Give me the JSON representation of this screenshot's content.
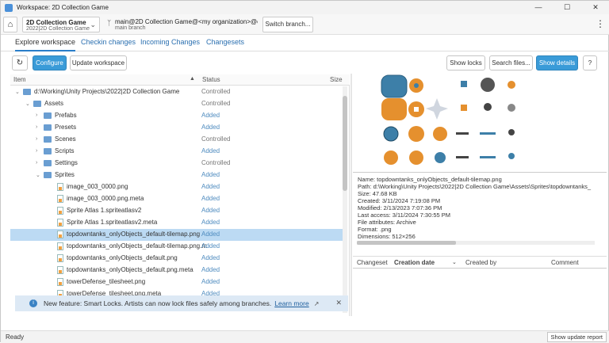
{
  "window": {
    "title": "Workspace: 2D Collection Game"
  },
  "topbar": {
    "repo_name": "2D Collection Game",
    "repo_sub": "2022|2D Collection Game",
    "branch_name": "main@2D Collection Game@<my organization>@cl",
    "branch_sub": "main branch",
    "switch_label": "Switch branch..."
  },
  "tabs": [
    {
      "label": "Explore workspace"
    },
    {
      "label": "Checkin changes"
    },
    {
      "label": "Incoming Changes"
    },
    {
      "label": "Changesets"
    }
  ],
  "toolbar": {
    "configure": "Configure",
    "update": "Update workspace",
    "show_locks": "Show locks",
    "search_files": "Search files...",
    "show_details": "Show details"
  },
  "table": {
    "col_item": "Item",
    "col_status": "Status",
    "col_size": "Size",
    "rows": [
      {
        "name": "d:\\Working\\Unity Projects\\2022|2D Collection Game",
        "status": "Controlled",
        "indent": 0,
        "kind": "folder",
        "exp": "open"
      },
      {
        "name": "Assets",
        "status": "Controlled",
        "indent": 1,
        "kind": "folder",
        "exp": "open"
      },
      {
        "name": "Prefabs",
        "status": "Added",
        "indent": 2,
        "kind": "folder",
        "exp": "closed"
      },
      {
        "name": "Presets",
        "status": "Added",
        "indent": 2,
        "kind": "folder",
        "exp": "closed"
      },
      {
        "name": "Scenes",
        "status": "Controlled",
        "indent": 2,
        "kind": "folder",
        "exp": "closed"
      },
      {
        "name": "Scripts",
        "status": "Added",
        "indent": 2,
        "kind": "folder",
        "exp": "closed"
      },
      {
        "name": "Settings",
        "status": "Controlled",
        "indent": 2,
        "kind": "folder",
        "exp": "closed"
      },
      {
        "name": "Sprites",
        "status": "Added",
        "indent": 2,
        "kind": "folder",
        "exp": "open"
      },
      {
        "name": "image_003_0000.png",
        "status": "Added",
        "indent": 3,
        "kind": "file"
      },
      {
        "name": "image_003_0000.png.meta",
        "status": "Added",
        "indent": 3,
        "kind": "file"
      },
      {
        "name": "Sprite Atlas 1.spriteatlasv2",
        "status": "Added",
        "indent": 3,
        "kind": "file"
      },
      {
        "name": "Sprite Atlas 1.spriteatlasv2.meta",
        "status": "Added",
        "indent": 3,
        "kind": "file"
      },
      {
        "name": "topdowntanks_onlyObjects_default-tilemap.png",
        "status": "Added",
        "indent": 3,
        "kind": "file",
        "selected": true
      },
      {
        "name": "topdowntanks_onlyObjects_default-tilemap.png.m",
        "status": "Added",
        "indent": 3,
        "kind": "file"
      },
      {
        "name": "topdowntanks_onlyObjects_default.png",
        "status": "Added",
        "indent": 3,
        "kind": "file"
      },
      {
        "name": "topdowntanks_onlyObjects_default.png.meta",
        "status": "Added",
        "indent": 3,
        "kind": "file"
      },
      {
        "name": "towerDefense_tilesheet.png",
        "status": "Added",
        "indent": 3,
        "kind": "file"
      },
      {
        "name": "towerDefense_tilesheet.png.meta",
        "status": "Added",
        "indent": 3,
        "kind": "file"
      }
    ]
  },
  "notice": {
    "text": "New feature: Smart Locks. Artists can now lock files safely among branches.",
    "link": "Learn more"
  },
  "details": {
    "name": "Name: topdowntanks_onlyObjects_default-tilemap.png",
    "path": "Path: d:\\Working\\Unity Projects\\2022|2D Collection Game\\Assets\\Sprites\\topdowntanks_",
    "size": "Size: 47.68 KB",
    "created": "Created: 3/11/2024 7:19:08 PM",
    "modified": "Modified: 2/13/2023 7:07:36 PM",
    "last_access": "Last access: 3/11/2024 7:30:55 PM",
    "attributes": "File attributes: Archive",
    "format": "Format: .png",
    "dimensions": "Dimensions: 512×256"
  },
  "changesets": {
    "col_changeset": "Changeset",
    "col_creation": "Creation date",
    "col_created_by": "Created by",
    "col_comment": "Comment"
  },
  "status": {
    "text": "Ready",
    "report_btn": "Show update report"
  },
  "colors": {
    "accent": "#3a9bd8",
    "selection": "#bcdaf3",
    "orange": "#e5902e",
    "blue_sprite": "#3d7fa8"
  }
}
